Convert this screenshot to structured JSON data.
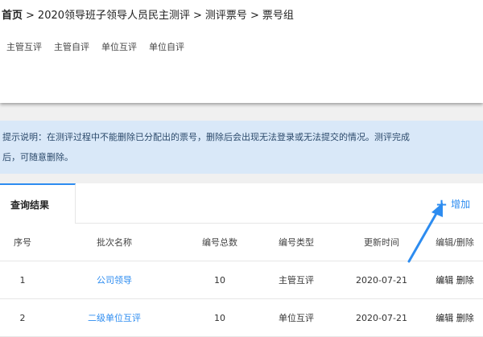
{
  "breadcrumb": {
    "home": "首页",
    "separator": ">",
    "items": [
      "2020领导班子领导人员民主测评",
      "测评票号",
      "票号组"
    ]
  },
  "subnav": {
    "items": [
      "主管互评",
      "主管自评",
      "单位互评",
      "单位自评"
    ]
  },
  "tips": {
    "line1": "提示说明：在测评过程中不能删除已分配出的票号，删除后会出现无法登录或无法提交的情况。测评完成",
    "line2": "后，可随意删除。"
  },
  "tab": {
    "label": "查询结果"
  },
  "add_button": {
    "icon": "+",
    "label": "增加"
  },
  "table": {
    "columns": [
      "序号",
      "批次名称",
      "编号总数",
      "编号类型",
      "更新时间",
      "编辑/删除"
    ],
    "rows": [
      {
        "index": "1",
        "name": "公司领导",
        "total": "10",
        "type": "主管互评",
        "updated": "2020-07-21",
        "edit": "编辑",
        "delete": "删除"
      },
      {
        "index": "2",
        "name": "二级单位互评",
        "total": "10",
        "type": "单位互评",
        "updated": "2020-07-21",
        "edit": "编辑",
        "delete": "删除"
      }
    ]
  },
  "colors": {
    "accent": "#2d8cf0",
    "tips_background": "#d9e8f8",
    "annotation_arrow": "#2d8cf0"
  }
}
